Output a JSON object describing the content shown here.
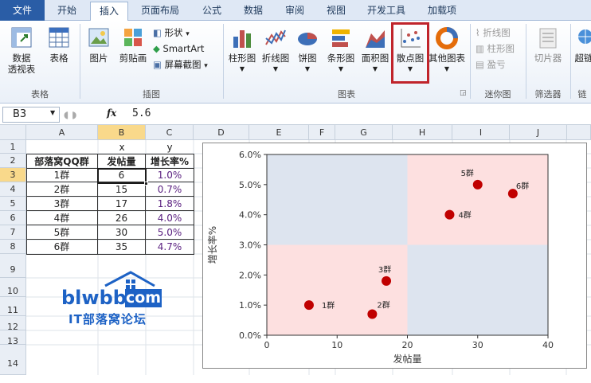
{
  "ribbon_tabs": [
    "文件",
    "开始",
    "插入",
    "页面布局",
    "公式",
    "数据",
    "审阅",
    "视图",
    "开发工具",
    "加载项"
  ],
  "ribbon": {
    "pivot_label_1": "数据",
    "pivot_label_2": "透视表",
    "table_label": "表格",
    "picture_label": "图片",
    "clipart_label": "剪贴画",
    "shapes_label": "形状",
    "smartart_label": "SmartArt",
    "screenshot_label": "屏幕截图",
    "column_chart_label": "柱形图",
    "line_chart_label": "折线图",
    "pie_chart_label": "饼图",
    "bar_chart_label": "条形图",
    "area_chart_label": "面积图",
    "scatter_chart_label": "散点图",
    "other_chart_label": "其他图表",
    "spark_line_label": "折线图",
    "spark_column_label": "柱形图",
    "spark_winloss_label": "盈亏",
    "slicer_label": "切片器",
    "hyperlink_label": "超链",
    "group_table": "表格",
    "group_illustration": "插图",
    "group_chart": "图表",
    "group_sparkline": "迷你图",
    "group_filter": "筛选器",
    "group_link": "链"
  },
  "formula_bar": {
    "name_box": "B3",
    "fx": "fx",
    "value": "5.6"
  },
  "columns": [
    "A",
    "B",
    "C",
    "D",
    "E",
    "F",
    "G",
    "H",
    "I",
    "J"
  ],
  "rows": [
    "1",
    "2",
    "3",
    "4",
    "5",
    "6",
    "7",
    "8",
    "9",
    "10",
    "11",
    "12",
    "13",
    "14"
  ],
  "sheet": {
    "row1": {
      "b": "x",
      "c": "y"
    },
    "headers": {
      "a": "部落窝QQ群",
      "b": "发帖量",
      "c": "增长率%"
    },
    "data": [
      {
        "group": "1群",
        "posts": "6",
        "rate": "1.0%"
      },
      {
        "group": "2群",
        "posts": "15",
        "rate": "0.7%"
      },
      {
        "group": "3群",
        "posts": "17",
        "rate": "1.8%"
      },
      {
        "group": "4群",
        "posts": "26",
        "rate": "4.0%"
      },
      {
        "group": "5群",
        "posts": "30",
        "rate": "5.0%"
      },
      {
        "group": "6群",
        "posts": "35",
        "rate": "4.7%"
      }
    ]
  },
  "watermark": {
    "url": "blwbbs.",
    "com": "com",
    "name": "IT部落窝论坛"
  },
  "chart_data": {
    "type": "scatter",
    "xlabel": "发帖量",
    "ylabel": "增长率%",
    "xlim": [
      0,
      40
    ],
    "ylim": [
      0,
      0.06
    ],
    "x_ticks": [
      "0",
      "10",
      "20",
      "30",
      "40"
    ],
    "y_ticks": [
      "0.0%",
      "1.0%",
      "2.0%",
      "3.0%",
      "4.0%",
      "5.0%",
      "6.0%"
    ],
    "points": [
      {
        "label": "1群",
        "x": 6,
        "y": 0.01
      },
      {
        "label": "2群",
        "x": 15,
        "y": 0.007
      },
      {
        "label": "3群",
        "x": 17,
        "y": 0.018
      },
      {
        "label": "4群",
        "x": 26,
        "y": 0.04
      },
      {
        "label": "5群",
        "x": 30,
        "y": 0.05
      },
      {
        "label": "6群",
        "x": 35,
        "y": 0.047
      }
    ],
    "quadrant_split": {
      "x": 20,
      "y": 0.03
    },
    "colors": {
      "marker": "#c00000",
      "quad_pink": "#fde0e0",
      "quad_blue": "#dde4ef"
    }
  }
}
